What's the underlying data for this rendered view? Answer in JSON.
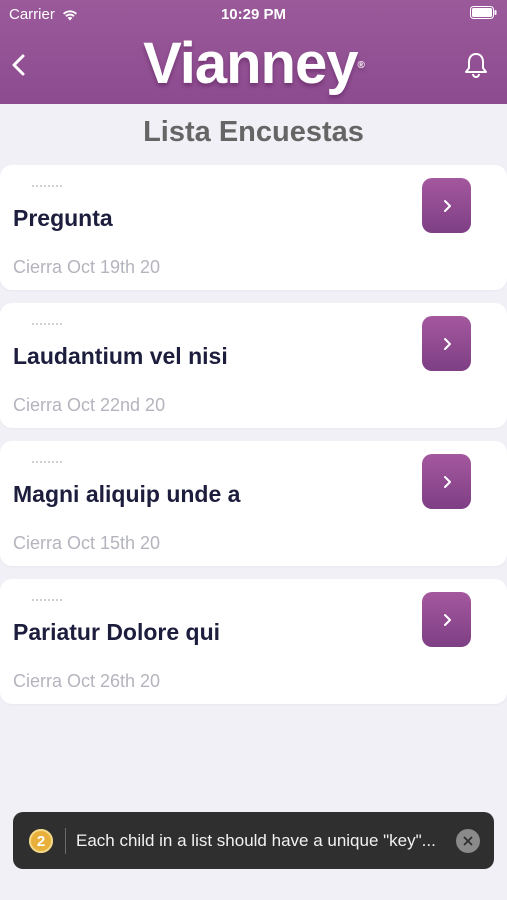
{
  "status_bar": {
    "carrier": "Carrier",
    "time": "10:29 PM"
  },
  "header": {
    "brand": "Vianney",
    "brand_mark": "®",
    "back_icon": "chevron-left-icon",
    "bell_icon": "bell-icon"
  },
  "page": {
    "title": "Lista Encuestas"
  },
  "surveys": [
    {
      "title": "Pregunta",
      "date": "Cierra Oct 19th 20"
    },
    {
      "title": "Laudantium vel nisi",
      "date": "Cierra Oct 22nd 20"
    },
    {
      "title": "Magni aliquip unde a",
      "date": "Cierra Oct 15th 20"
    },
    {
      "title": "Pariatur Dolore qui",
      "date": "Cierra Oct 26th 20"
    }
  ],
  "toast": {
    "count": "2",
    "message": "Each child in a list should have a unique \"key\"...",
    "close_icon": "close-icon"
  },
  "colors": {
    "brand": "#8c4b8f",
    "button": "#8e4a8f",
    "title_text": "#1d1d3d",
    "date_text": "#b4b4be",
    "toast_bg": "#2f2f2f",
    "badge": "#e8b03a"
  }
}
